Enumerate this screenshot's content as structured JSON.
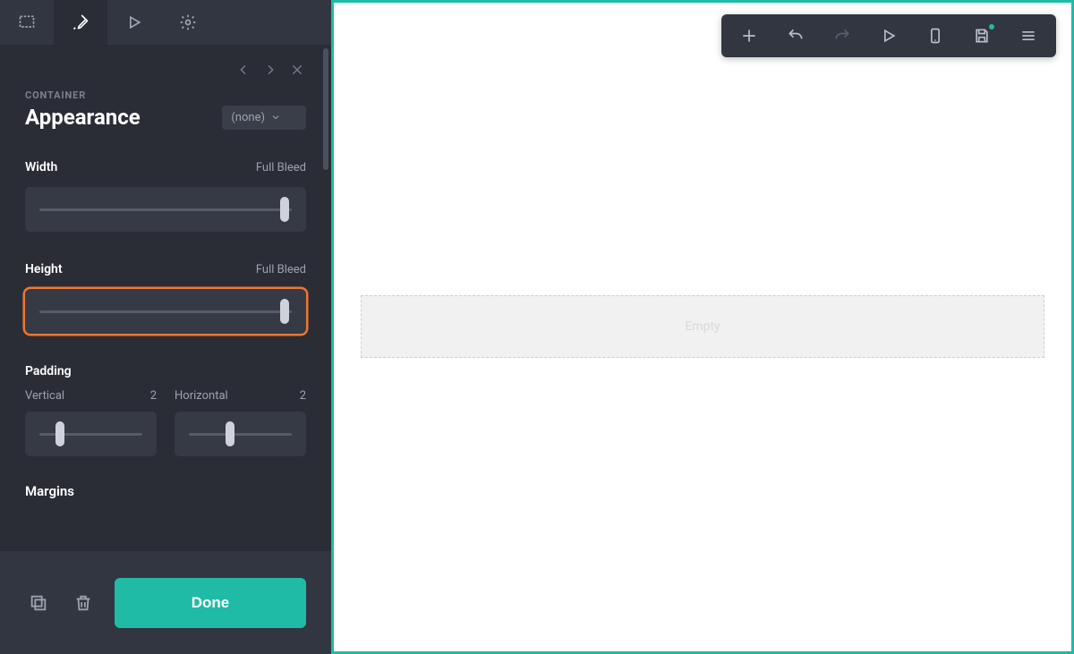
{
  "sidebar": {
    "tabs": [
      "select",
      "brush",
      "play",
      "settings"
    ],
    "active_tab_index": 1,
    "nav": {
      "back": "‹",
      "forward": "›",
      "close": "×"
    },
    "eyebrow": "CONTAINER",
    "title": "Appearance",
    "preset_label": "(none)",
    "width": {
      "label": "Width",
      "value": "Full Bleed",
      "slider_pos": 0.97
    },
    "height": {
      "label": "Height",
      "value": "Full Bleed",
      "slider_pos": 0.97,
      "highlighted": true
    },
    "padding": {
      "label": "Padding",
      "vertical": {
        "label": "Vertical",
        "value": "2",
        "slider_pos": 0.2
      },
      "horizontal": {
        "label": "Horizontal",
        "value": "2",
        "slider_pos": 0.4
      }
    },
    "margins_label": "Margins",
    "footer": {
      "clone_tooltip": "Duplicate",
      "trash_tooltip": "Delete",
      "done_label": "Done"
    }
  },
  "canvas": {
    "empty_slot_label": "Empty"
  },
  "floating_toolbar": {
    "buttons": [
      "add",
      "undo",
      "redo",
      "play",
      "device",
      "save",
      "menu"
    ],
    "redo_disabled": true,
    "has_notification": true
  }
}
